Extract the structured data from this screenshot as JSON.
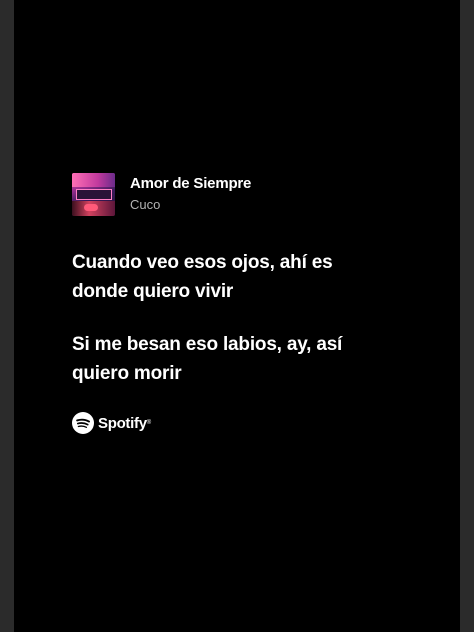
{
  "song": {
    "title": "Amor de Siempre",
    "artist": "Cuco",
    "cover_icon": "album-cover-art"
  },
  "lyrics": [
    "Cuando veo esos ojos, ahí es donde quiero vivir",
    "Si me besan eso labios, ay, así quiero morir"
  ],
  "brand": {
    "name": "Spotify",
    "icon": "spotify-logo-icon"
  },
  "colors": {
    "background": "#000000",
    "outer_background": "#2b2b2b",
    "text_primary": "#ffffff",
    "text_secondary": "#b3b3b3"
  }
}
